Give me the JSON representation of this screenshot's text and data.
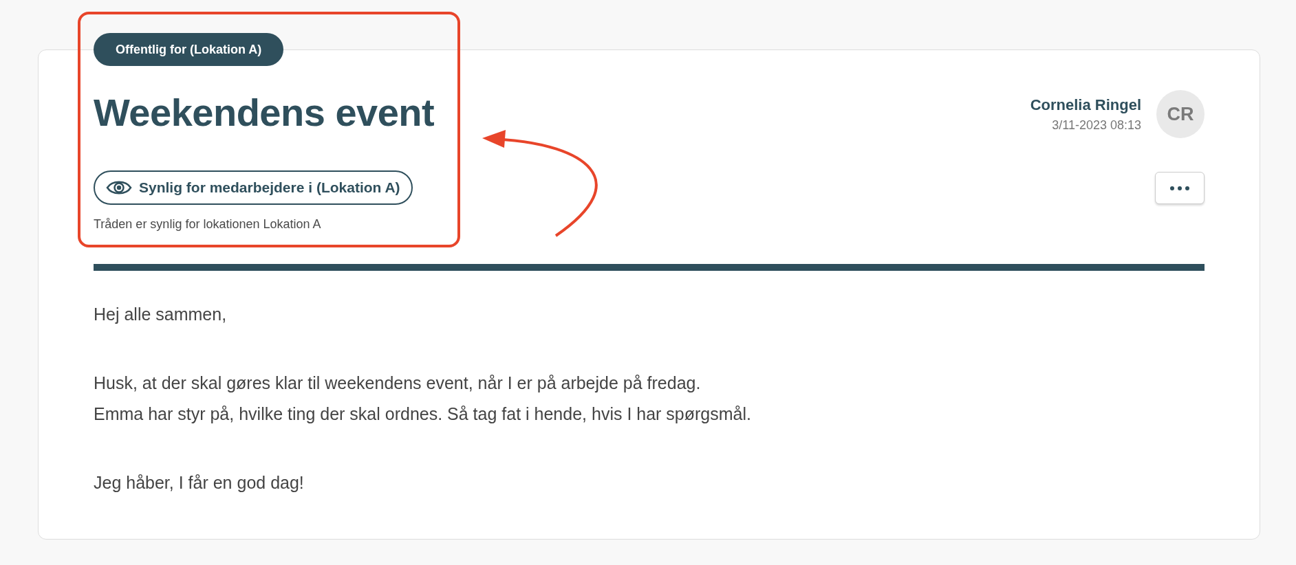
{
  "post": {
    "audience_badge": "Offentlig for (Lokation A)",
    "title": "Weekendens event",
    "author": {
      "name": "Cornelia Ringel",
      "date": "3/11-2023 08:13",
      "initials": "CR"
    },
    "visibility": {
      "label": "Synlig for medarbejdere i (Lokation A)",
      "description": "Tråden er synlig for lokationen Lokation A"
    },
    "body": [
      [
        "Hej alle sammen,"
      ],
      [
        "Husk, at der skal gøres klar til weekendens event, når I er på arbejde på fredag.",
        "Emma har styr på, hvilke ting der skal ordnes. Så tag fat i hende, hvis I har spørgsmål."
      ],
      [
        "Jeg håber, I får en god dag!"
      ]
    ]
  }
}
